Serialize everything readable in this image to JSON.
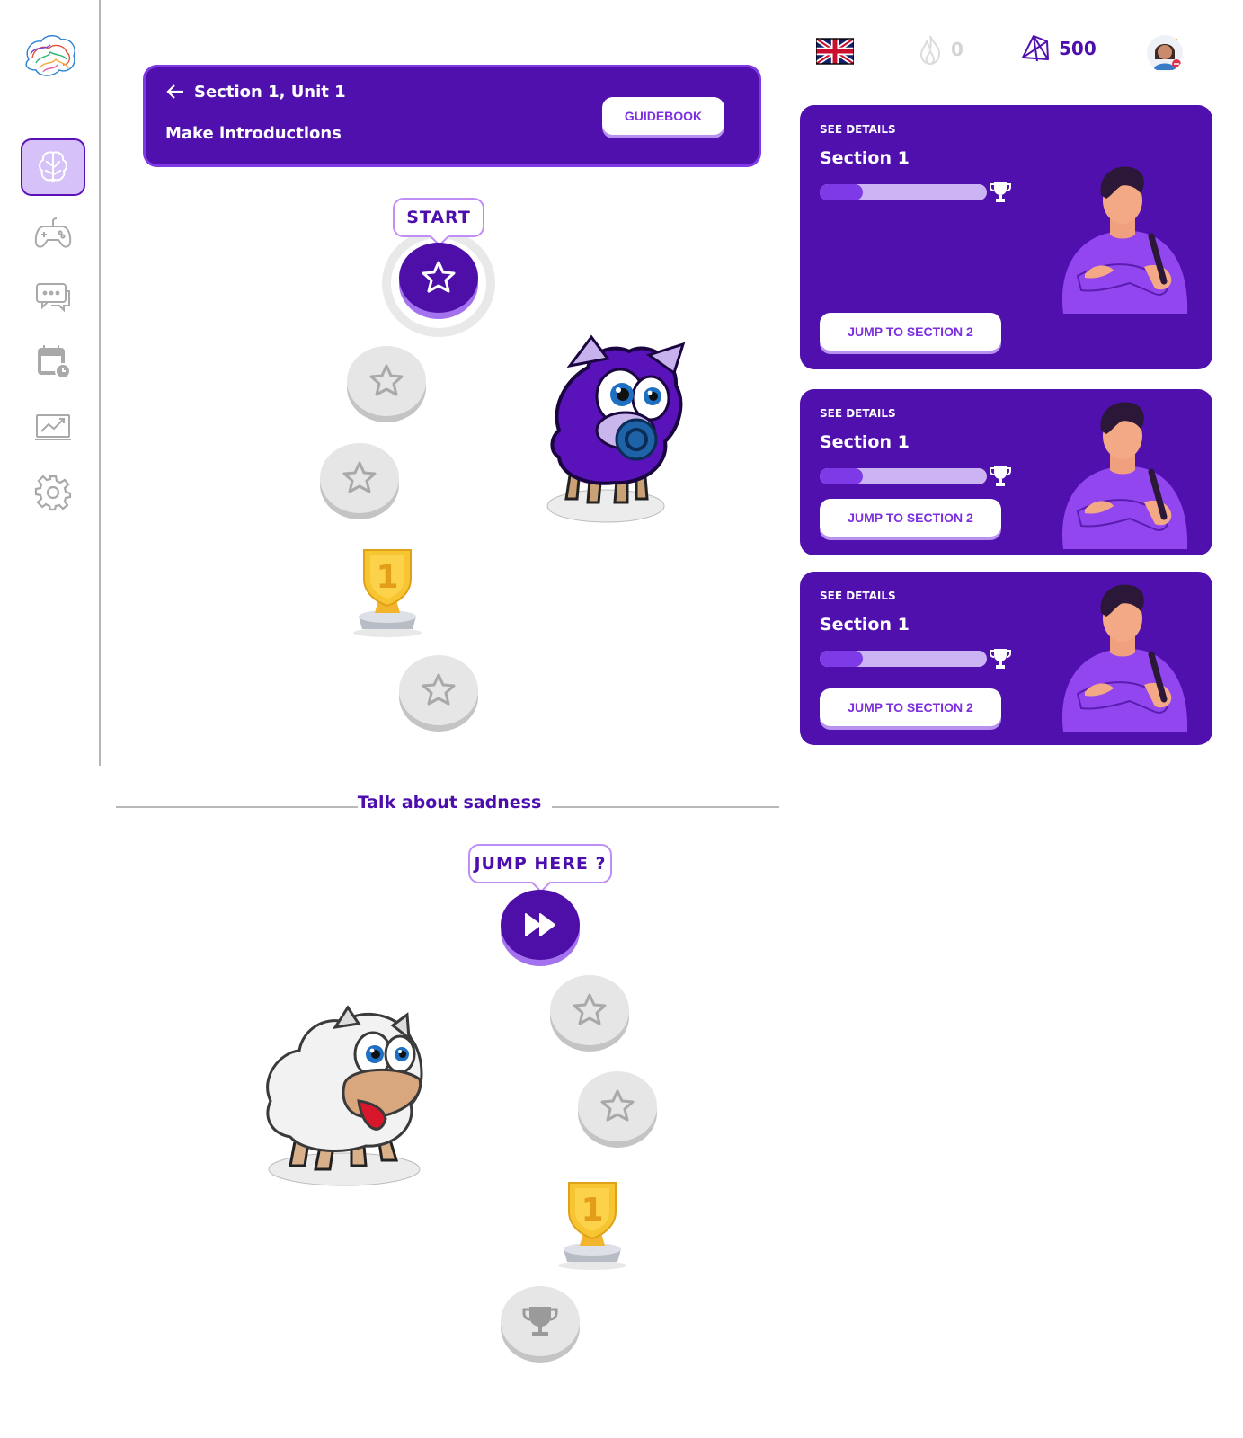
{
  "sidebar": {
    "logo": "brain-logo",
    "items": [
      {
        "icon": "brain-icon",
        "active": true
      },
      {
        "icon": "gamepad-icon",
        "active": false
      },
      {
        "icon": "chat-icon",
        "active": false
      },
      {
        "icon": "calendar-clock-icon",
        "active": false
      },
      {
        "icon": "chart-icon",
        "active": false
      },
      {
        "icon": "gear-icon",
        "active": false
      }
    ]
  },
  "unit": {
    "section_label": "Section 1, Unit 1",
    "title": "Make introductions",
    "guidebook_label": "GUIDEBOOK"
  },
  "path1": {
    "start_label": "START"
  },
  "divider": {
    "label": "Talk about sadness"
  },
  "path2": {
    "jump_label": "JUMP HERE ?"
  },
  "stats": {
    "language_flag": "uk-flag-icon",
    "streak": "0",
    "gems": "500"
  },
  "cards": [
    {
      "see_details": "SEE DETAILS",
      "title": "Section 1",
      "progress": 0.26,
      "jump_label": "JUMP TO SECTION 2"
    },
    {
      "see_details": "SEE DETAILS",
      "title": "Section 1",
      "progress": 0.26,
      "jump_label": "JUMP TO SECTION 2"
    },
    {
      "see_details": "SEE DETAILS",
      "title": "Section 1",
      "progress": 0.26,
      "jump_label": "JUMP TO SECTION 2"
    }
  ],
  "colors": {
    "primary": "#5010ae",
    "accent": "#7d3ae6",
    "light_accent": "#d6c1f8",
    "node_inactive": "#e6e6e6"
  }
}
